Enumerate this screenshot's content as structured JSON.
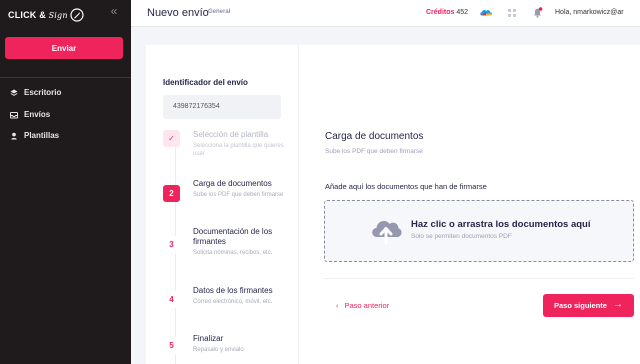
{
  "sidebar": {
    "logo_text": "CLICK & ",
    "logo_script": "Sign",
    "send_label": "Enviar",
    "items": [
      {
        "label": "Escritorio",
        "icon": "stack-icon"
      },
      {
        "label": "Envíos",
        "icon": "inbox-icon"
      },
      {
        "label": "Plantillas",
        "icon": "person-pin-icon"
      }
    ]
  },
  "topbar": {
    "title": "Nuevo envío",
    "subtitle": "General",
    "credits_label": "Créditos",
    "credits_value": "452",
    "greeting": "Hola, nmarkowicz@ar"
  },
  "sendid": {
    "label": "Identificador del envío",
    "value": "439872176354"
  },
  "steps": [
    {
      "num": "✓",
      "title": "Selección de plantilla",
      "desc": "Selecciona la plantilla que quieres usar",
      "state": "done"
    },
    {
      "num": "2",
      "title": "Carga de documentos",
      "desc": "Sube los PDF que deben firmarse",
      "state": "active"
    },
    {
      "num": "3",
      "title": "Documentación de los firmantes",
      "desc": "Solicita nóminas, recibos, etc.",
      "state": "pending"
    },
    {
      "num": "4",
      "title": "Datos de los firmantes",
      "desc": "Correo electrónico, móvil, etc.",
      "state": "pending"
    },
    {
      "num": "5",
      "title": "Finalizar",
      "desc": "Repasalo y envialo",
      "state": "pending"
    }
  ],
  "main": {
    "title": "Carga de documentos",
    "subtitle": "Sube los PDF que deben firmarse",
    "drop_label": "Añade aquí los documentos que han de firmarse",
    "drop_main": "Haz clic o arrastra los documentos aquí",
    "drop_hint": "Solo se permiten documentos PDF",
    "prev_label": "Paso anterior",
    "next_label": "Paso siguiente"
  },
  "colors": {
    "accent": "#f0245d",
    "sidebar_bg": "#1f1a1b",
    "text_dark": "#26264a"
  }
}
